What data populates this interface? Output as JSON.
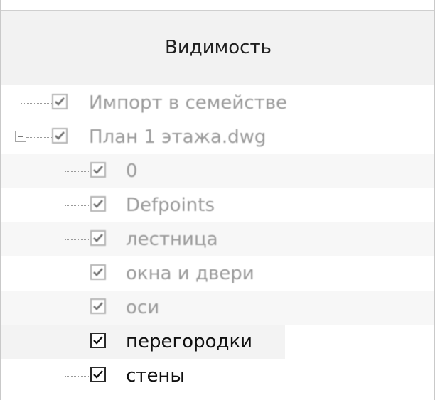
{
  "header": {
    "title": "Видимость"
  },
  "tree": {
    "rows": [
      {
        "label": "Импорт в семействе",
        "checked": true,
        "level": 0,
        "style": "imported"
      },
      {
        "label": "План 1 этажа.dwg",
        "checked": true,
        "level": 0,
        "style": "imported",
        "expanded": true
      },
      {
        "label": "0",
        "checked": true,
        "level": 1,
        "style": "imported"
      },
      {
        "label": "Defpoints",
        "checked": true,
        "level": 1,
        "style": "imported"
      },
      {
        "label": "лестница",
        "checked": true,
        "level": 1,
        "style": "imported"
      },
      {
        "label": "окна и двери",
        "checked": true,
        "level": 1,
        "style": "imported"
      },
      {
        "label": "оси",
        "checked": true,
        "level": 1,
        "style": "imported"
      },
      {
        "label": "перегородки",
        "checked": true,
        "level": 1,
        "style": "active"
      },
      {
        "label": "стены",
        "checked": true,
        "level": 1,
        "style": "active"
      }
    ]
  },
  "icons": {
    "checkmark": "check-icon",
    "expander": "collapse-minus-icon"
  },
  "colors": {
    "header_bg": "#f2f2f2",
    "imported_text": "#9a9a9a",
    "active_text": "#111111"
  }
}
